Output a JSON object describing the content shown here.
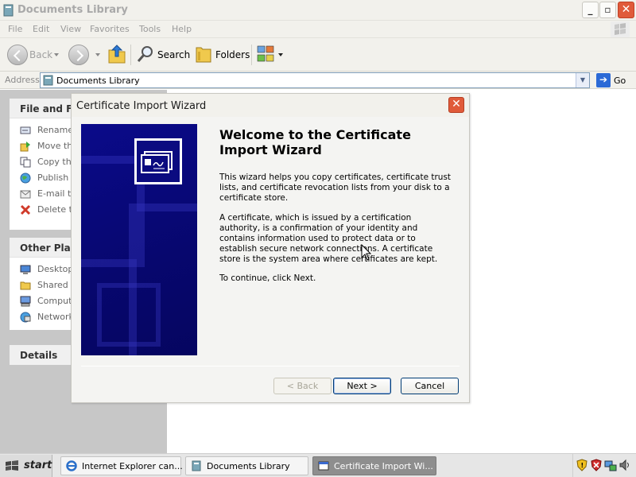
{
  "explorer": {
    "title": "Documents Library",
    "menu": [
      "File",
      "Edit",
      "View",
      "Favorites",
      "Tools",
      "Help"
    ],
    "toolbar": {
      "back": "Back",
      "search": "Search",
      "folders": "Folders"
    },
    "address": {
      "label": "Address",
      "value": "Documents Library",
      "go": "Go"
    }
  },
  "left_panel": {
    "file_tasks": {
      "title": "File and Fol",
      "items": [
        "Rename",
        "Move thi",
        "Copy thi",
        "Publish t",
        "E-mail th",
        "Delete th"
      ]
    },
    "other_places": {
      "title": "Other Place",
      "items": [
        "Desktop",
        "Shared D",
        "Compute",
        "Network"
      ]
    },
    "details": {
      "title": "Details"
    }
  },
  "dialog": {
    "title": "Certificate Import Wizard",
    "heading": "Welcome to the Certificate Import Wizard",
    "paragraphs": [
      "This wizard helps you copy certificates, certificate trust lists, and certificate revocation lists from your disk to a certificate store.",
      "A certificate, which is issued by a certification authority, is a confirmation of your identity and contains information used to protect data or to establish secure network connections. A certificate store is the system area where certificates are kept.",
      "To continue, click Next."
    ],
    "buttons": {
      "back": "< Back",
      "next": "Next >",
      "cancel": "Cancel"
    }
  },
  "taskbar": {
    "start": "start",
    "items": [
      "Internet Explorer can...",
      "Documents Library",
      "Certificate Import Wi..."
    ]
  }
}
